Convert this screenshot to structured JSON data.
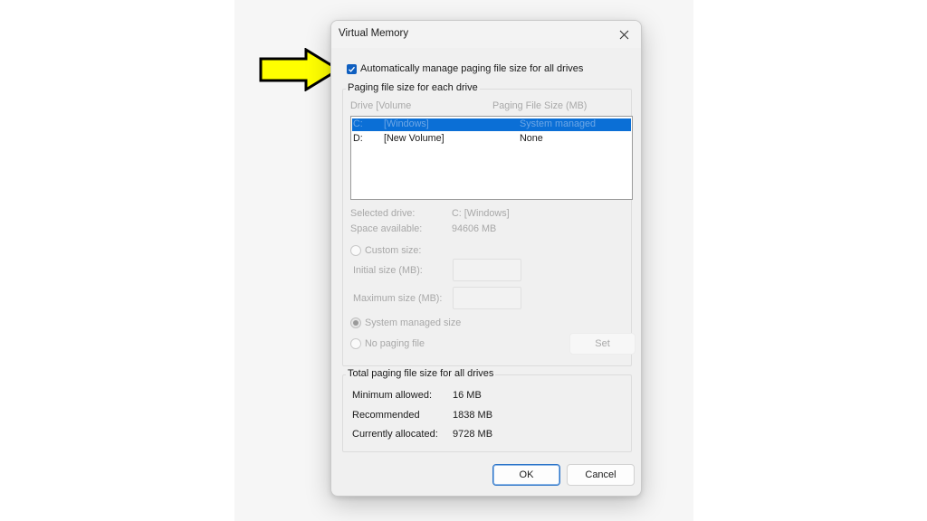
{
  "dialog": {
    "title": "Virtual Memory",
    "close_icon": "close-icon"
  },
  "auto_manage": {
    "label": "Automatically manage paging file size for all drives",
    "checked": true
  },
  "per_drive": {
    "legend": "Paging file size for each drive",
    "columns": [
      "Drive  [Volume",
      "Paging File Size (MB)"
    ],
    "drives": [
      {
        "drive": "C:",
        "volume": "[Windows]",
        "size": "System managed",
        "selected": true
      },
      {
        "drive": "D:",
        "volume": "[New Volume]",
        "size": "None",
        "selected": false
      }
    ],
    "selected_drive_label": "Selected drive:",
    "selected_drive_value": "C:  [Windows]",
    "space_available_label": "Space available:",
    "space_available_value": "94606 MB",
    "custom_size_label": "Custom size:",
    "initial_size_label": "Initial size (MB):",
    "initial_size_value": "",
    "maximum_size_label": "Maximum size (MB):",
    "maximum_size_value": "",
    "system_managed_label": "System managed size",
    "no_paging_label": "No paging file",
    "selected_option": "system_managed",
    "set_label": "Set"
  },
  "totals": {
    "legend": "Total paging file size for all drives",
    "rows": [
      {
        "label": "Minimum allowed:",
        "value": "16 MB"
      },
      {
        "label": "Recommended",
        "value": "1838 MB"
      },
      {
        "label": "Currently allocated:",
        "value": "9728 MB"
      }
    ]
  },
  "buttons": {
    "ok": "OK",
    "cancel": "Cancel"
  },
  "annotation": {
    "arrow_icon": "yellow-arrow-icon",
    "arrow_color": "#ffff00"
  }
}
